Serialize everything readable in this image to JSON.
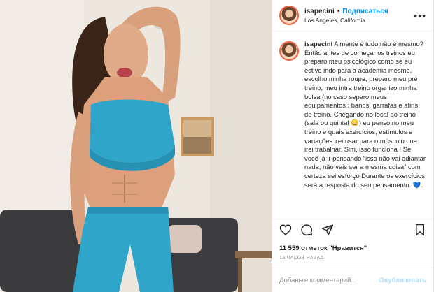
{
  "post": {
    "photo_alt": "",
    "colors": {
      "accent": "#0095f6",
      "outfit": "#2fa6c9",
      "wall": "#e9e4dc"
    }
  },
  "header": {
    "username": "isapecini",
    "separator": "•",
    "follow_label": "Подписаться",
    "location": "Los Angeles, California",
    "more_icon": "more-icon"
  },
  "caption": {
    "username": "isapecini",
    "text": "A mente é tudo não é mesmo? Então antes de começar os treinos eu preparo meu psicológico como se eu estive indo para a academia mesmo, escolho minha roupa, preparo meu pré treino, meu intra treino organizo minha bolsa (no caso separo meus equipamentos : bands, garrafas e afins, de treino. Chegando no local do treino (sala ou quintal 😄) eu penso no meu treino e quais exercícios, estímulos e variações irei usar para o músculo que irei trabalhar. Sim, isso funciona ! Se você já ir pensando “isso não vai adiantar nada, não vais ser a mesma coisa” com certeza sei esforço Durante os exercícios será a resposta do seu pensamento. 💙."
  },
  "actions": {
    "icons": [
      "heart-icon",
      "comment-icon",
      "share-icon",
      "bookmark-icon"
    ]
  },
  "likes": "11 559 отметок \"Нравится\"",
  "timestamp": "13 ЧАСОВ НАЗАД",
  "comment_box": {
    "placeholder": "Добавьте комментарий...",
    "publish_label": "Опубликовать"
  }
}
